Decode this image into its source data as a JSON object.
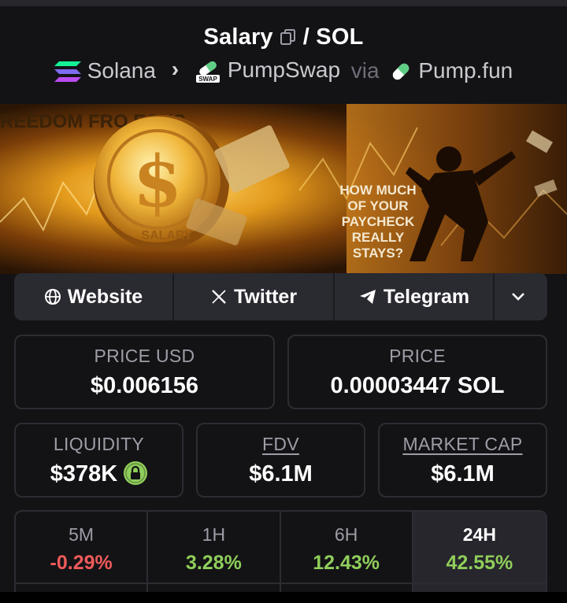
{
  "pair": {
    "base": "Salary",
    "separator": "/",
    "quote": "SOL"
  },
  "breadcrumb": {
    "chain": "Solana",
    "dex": "PumpSwap",
    "dex_badge": "SWAP",
    "via": "via",
    "launchpad": "Pump.fun"
  },
  "banner": {
    "lines": [
      "HOW MUCH",
      "OF YOUR",
      "PAYCHECK",
      "REALLY",
      "STAYS?"
    ],
    "headline": "REEDOM  FRO       ECKS",
    "coin_text": "SALARY"
  },
  "links": {
    "website": "Website",
    "twitter": "Twitter",
    "telegram": "Telegram"
  },
  "stats": {
    "price_usd": {
      "label": "PRICE USD",
      "value": "$0.006156"
    },
    "price_sol": {
      "label": "PRICE",
      "value": "0.00003447 SOL"
    },
    "liquidity": {
      "label": "LIQUIDITY",
      "value": "$378K"
    },
    "fdv": {
      "label": "FDV",
      "value": "$6.1M"
    },
    "market_cap": {
      "label": "MARKET CAP",
      "value": "$6.1M"
    }
  },
  "timeframes": [
    {
      "period": "5M",
      "change": "-0.29%"
    },
    {
      "period": "1H",
      "change": "3.28%"
    },
    {
      "period": "6H",
      "change": "12.43%"
    },
    {
      "period": "24H",
      "change": "42.55%"
    }
  ],
  "colors": {
    "background": "#131316",
    "card_border": "#2c2c33",
    "positive": "#8fce5a",
    "negative": "#ef5a5a",
    "muted": "#9d9da6"
  },
  "active_timeframe": "24H"
}
